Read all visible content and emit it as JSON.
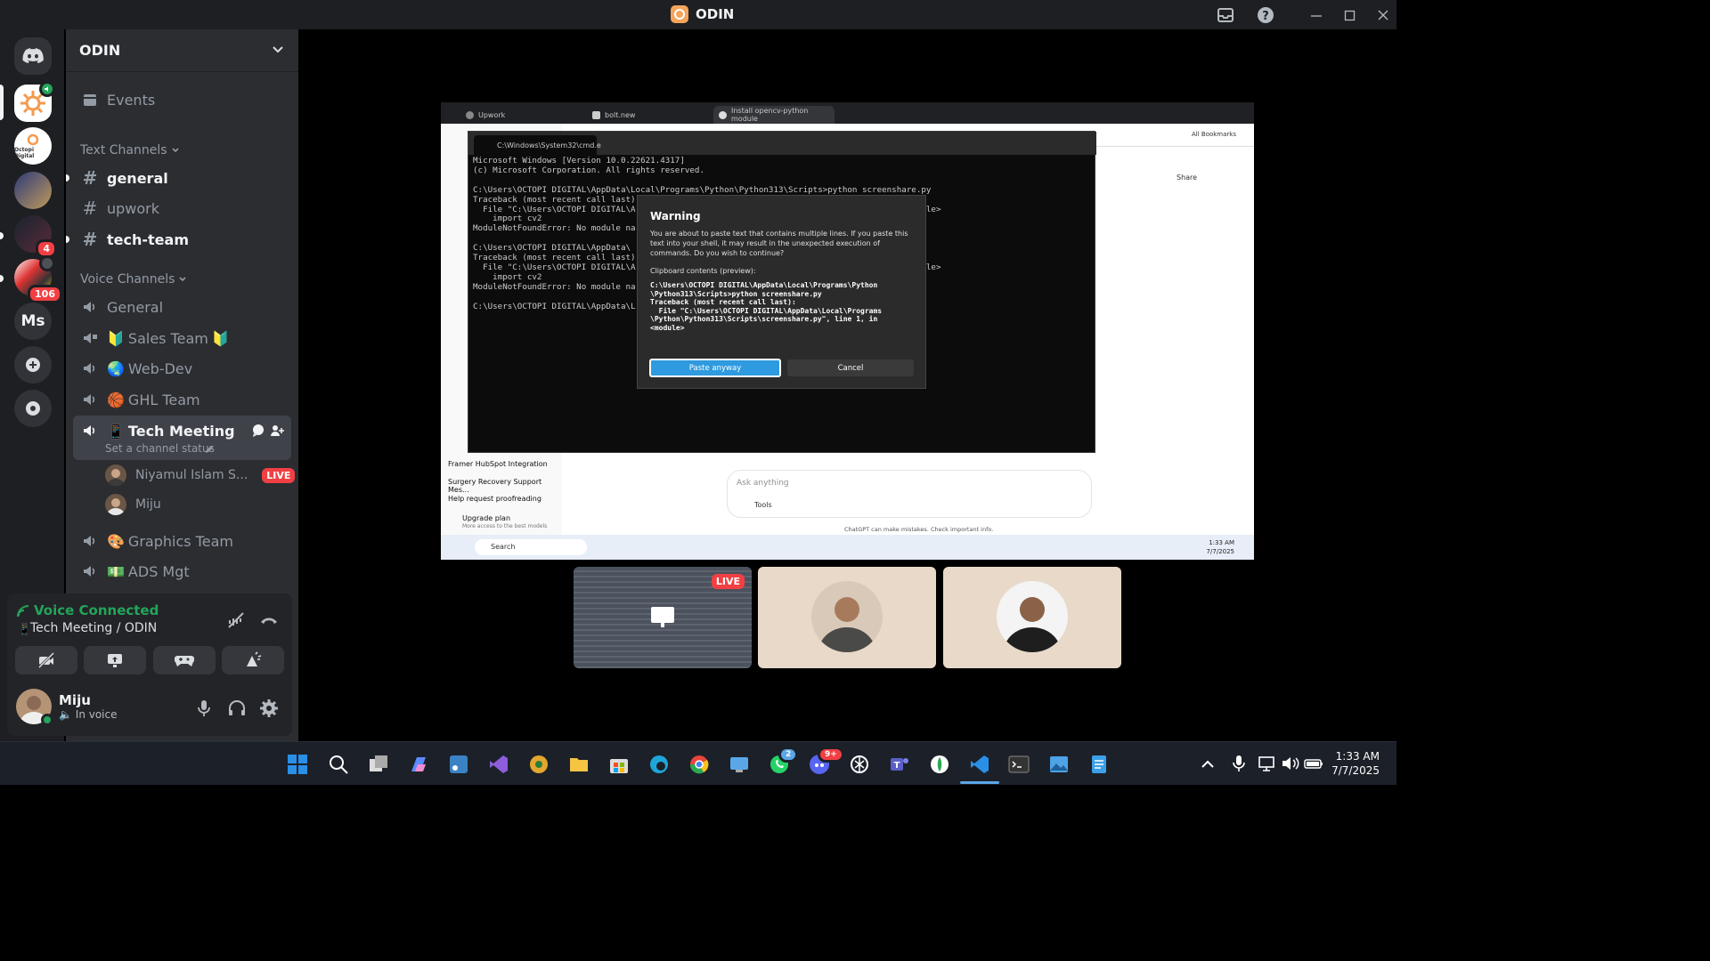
{
  "app": {
    "title": "ODIN"
  },
  "server": {
    "name": "ODIN"
  },
  "rail": {
    "badges": [
      {
        "count": "4"
      },
      {
        "count": "106"
      }
    ],
    "ms_label": "Ms",
    "octopi_label": "Octopi Digital"
  },
  "sidebar": {
    "events_label": "Events",
    "text_category": "Text Channels",
    "text_channels": [
      {
        "name": "general",
        "unread": true
      },
      {
        "name": "upwork",
        "unread": false
      },
      {
        "name": "tech-team",
        "unread": true
      }
    ],
    "voice_category": "Voice Channels",
    "voice_channels": [
      {
        "name": "General",
        "emoji": ""
      },
      {
        "name": "Sales Team",
        "emoji": "🔰",
        "emoji_after": "🔰"
      },
      {
        "name": "Web-Dev",
        "emoji": "🌏"
      },
      {
        "name": "GHL Team",
        "emoji": "🏀"
      },
      {
        "name": "Tech Meeting",
        "emoji": "📱",
        "status": "Set a channel status",
        "selected": true
      },
      {
        "name": "Graphics Team",
        "emoji": "🎨"
      },
      {
        "name": "ADS Mgt",
        "emoji": "💵"
      }
    ],
    "members": [
      {
        "name": "Niyamul Islam S...",
        "live": "LIVE"
      },
      {
        "name": "Miju",
        "live": ""
      }
    ]
  },
  "voice": {
    "status": "Voice Connected",
    "channel": "Tech Meeting / ODIN"
  },
  "user": {
    "name": "Miju",
    "status": "In voice"
  },
  "stream": {
    "browser_tabs": [
      "Upwork",
      "bolt.new",
      "Install opencv-python module"
    ],
    "cmd_tab": "C:\\Windows\\System32\\cmd.e",
    "cmd_lines": [
      "Microsoft Windows [Version 10.0.22621.4317]",
      "(c) Microsoft Corporation. All rights reserved.",
      "",
      "C:\\Users\\OCTOPI DIGITAL\\AppData\\Local\\Programs\\Python\\Python313\\Scripts>python screenshare.py",
      "Traceback (most recent call last):",
      "  File \"C:\\Users\\OCTOPI DIGITAL\\A                                   re.py\", line 1, in <module>",
      "    import cv2",
      "ModuleNotFoundError: No module na",
      "",
      "C:\\Users\\OCTOPI DIGITAL\\AppData\\                                   y",
      "Traceback (most recent call last):",
      "  File \"C:\\Users\\OCTOPI DIGITAL\\A                                   re.py\", line 1, in <module>",
      "    import cv2",
      "ModuleNotFoundError: No module na",
      "",
      "C:\\Users\\OCTOPI DIGITAL\\AppData\\L"
    ],
    "warning": {
      "title": "Warning",
      "message": "You are about to paste text that contains multiple lines. If you paste this text into your shell, it may result in the unexpected execution of commands. Do you wish to continue?",
      "clipboard_label": "Clipboard contents (preview):",
      "clipboard_text": "C:\\Users\\OCTOPI DIGITAL\\AppData\\Local\\Programs\\Python\n\\Python313\\Scripts>python screenshare.py\nTraceback (most recent call last):\n  File \"C:\\Users\\OCTOPI DIGITAL\\AppData\\Local\\Programs\n\\Python\\Python313\\Scripts\\screenshare.py\", line 1, in\n<module>",
      "paste_label": "Paste anyway",
      "cancel_label": "Cancel"
    },
    "chat_items": [
      "Framer HubSpot Integration",
      "Surgery Recovery Support Mes...",
      "Help request proofreading"
    ],
    "upgrade": "Upgrade plan",
    "upgrade_sub": "More access to the best models",
    "ask_placeholder": "Ask anything",
    "tools_label": "Tools",
    "disclaimer": "ChatGPT can make mistakes. Check important info.",
    "share_label": "Share",
    "bookmarks_label": "All Bookmarks",
    "search_label": "Search",
    "inner_time": "1:33 AM",
    "inner_date": "7/7/2025"
  },
  "tiles": {
    "live_label": "LIVE"
  },
  "taskbar": {
    "time": "1:33 AM",
    "date": "7/7/2025",
    "whatsapp_badge": "2",
    "discord_badge": "9+"
  },
  "colors": {
    "accent": "#5865f2",
    "green": "#23a55a",
    "red": "#f23f43"
  }
}
